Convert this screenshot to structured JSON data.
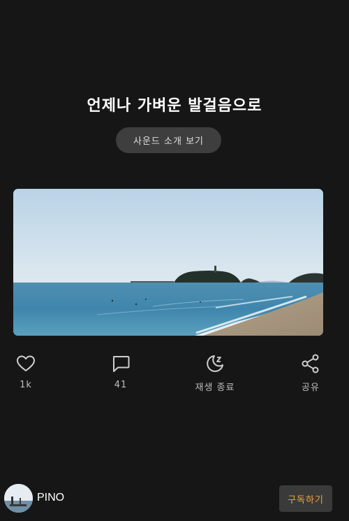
{
  "episode": {
    "title": "언제나 가벼운 발걸음으로",
    "intro_button_label": "사운드 소개 보기"
  },
  "actions": {
    "like": {
      "icon": "heart-icon",
      "label": "1k"
    },
    "comment": {
      "icon": "comment-icon",
      "label": "41"
    },
    "sleep_timer": {
      "icon": "moon-sleep-icon",
      "label": "재생 종료"
    },
    "share": {
      "icon": "share-icon",
      "label": "공유"
    }
  },
  "channel": {
    "name": "PINO",
    "subscribe_label": "구독하기"
  },
  "colors": {
    "background": "#161616",
    "button_bg": "#3e3e3e",
    "subscribe_text": "#f4a23c"
  }
}
